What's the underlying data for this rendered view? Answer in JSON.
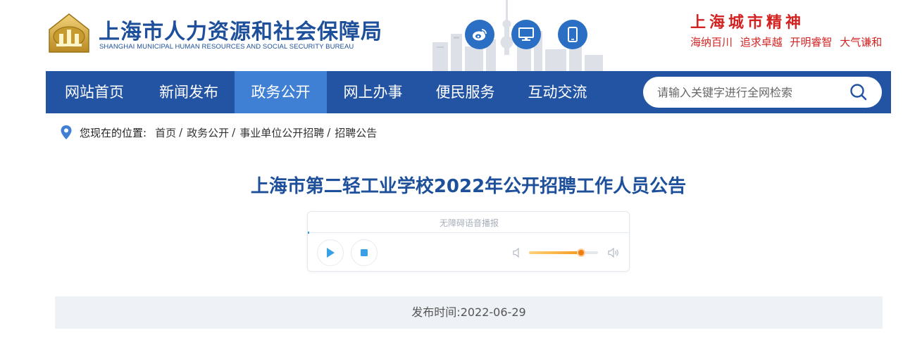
{
  "header": {
    "logo_cn": "上海市人力资源和社会保障局",
    "logo_en": "SHANGHAI MUNICIPAL HUMAN RESOURCES AND SOCIAL SECURITY BUREAU",
    "icons": [
      "weibo-icon",
      "desktop-icon",
      "mobile-icon"
    ],
    "spirit_title": "上海城市精神",
    "spirit_motto": "海纳百川 追求卓越 开明睿智 大气谦和"
  },
  "nav": {
    "items": [
      {
        "label": "网站首页",
        "active": false
      },
      {
        "label": "新闻发布",
        "active": false
      },
      {
        "label": "政务公开",
        "active": true
      },
      {
        "label": "网上办事",
        "active": false
      },
      {
        "label": "便民服务",
        "active": false
      },
      {
        "label": "互动交流",
        "active": false
      }
    ],
    "search_placeholder": "请输入关键字进行全网检索"
  },
  "breadcrumb": {
    "label": "您现在的位置:",
    "items": [
      "首页",
      "政务公开",
      "事业单位公开招聘",
      "招聘公告"
    ]
  },
  "article": {
    "title": "上海市第二轻工业学校2022年公开招聘工作人员公告",
    "publish_text": "发布时间:2022-06-29"
  },
  "player": {
    "label": "无障碍语音播报",
    "volume": 0.76
  },
  "colors": {
    "brand_blue": "#2354a3",
    "nav_active": "#3f80d5",
    "title_blue": "#1d4f9a",
    "spirit_red": "#d32222",
    "volume_orange": "#f07d12"
  }
}
